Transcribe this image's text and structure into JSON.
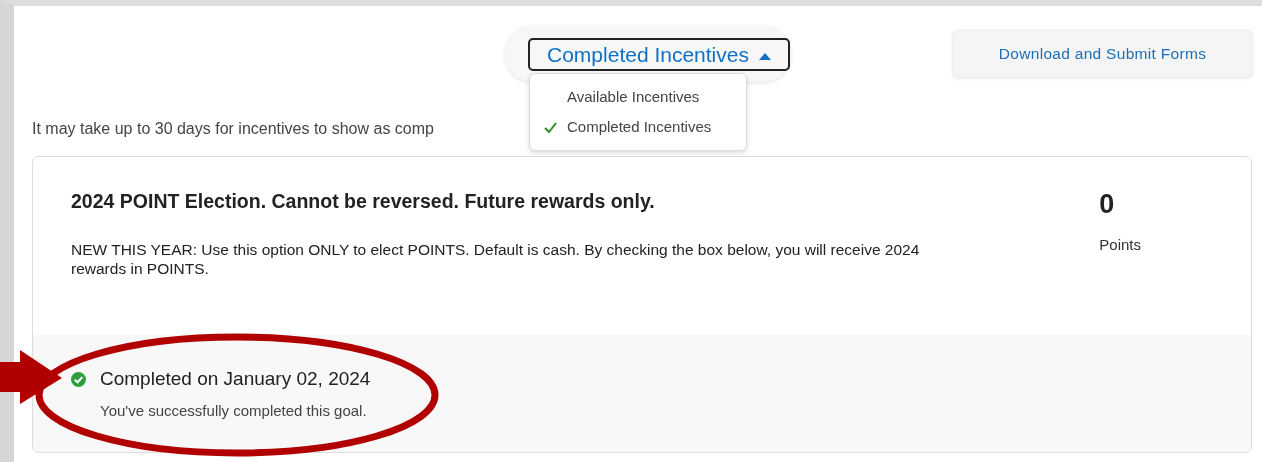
{
  "view_toggle": {
    "label": "Completed Incentives",
    "expanded": true
  },
  "view_menu": [
    {
      "label": "Available Incentives",
      "selected": false
    },
    {
      "label": "Completed Incentives",
      "selected": true
    }
  ],
  "download_button": "Download and Submit Forms",
  "notice": "It may take up to 30 days for incentives to show as comp",
  "incentive": {
    "title": "2024 POINT Election. Cannot be reversed. Future rewards only.",
    "description": "NEW THIS YEAR: Use this option ONLY to elect POINTS. Default is cash. By checking the box below, you will receive 2024 rewards in POINTS.",
    "points": "0",
    "points_label": "Points",
    "completed": true,
    "completed_text": "Completed on January 02, 2024",
    "completed_message": "You've successfully completed this goal."
  }
}
